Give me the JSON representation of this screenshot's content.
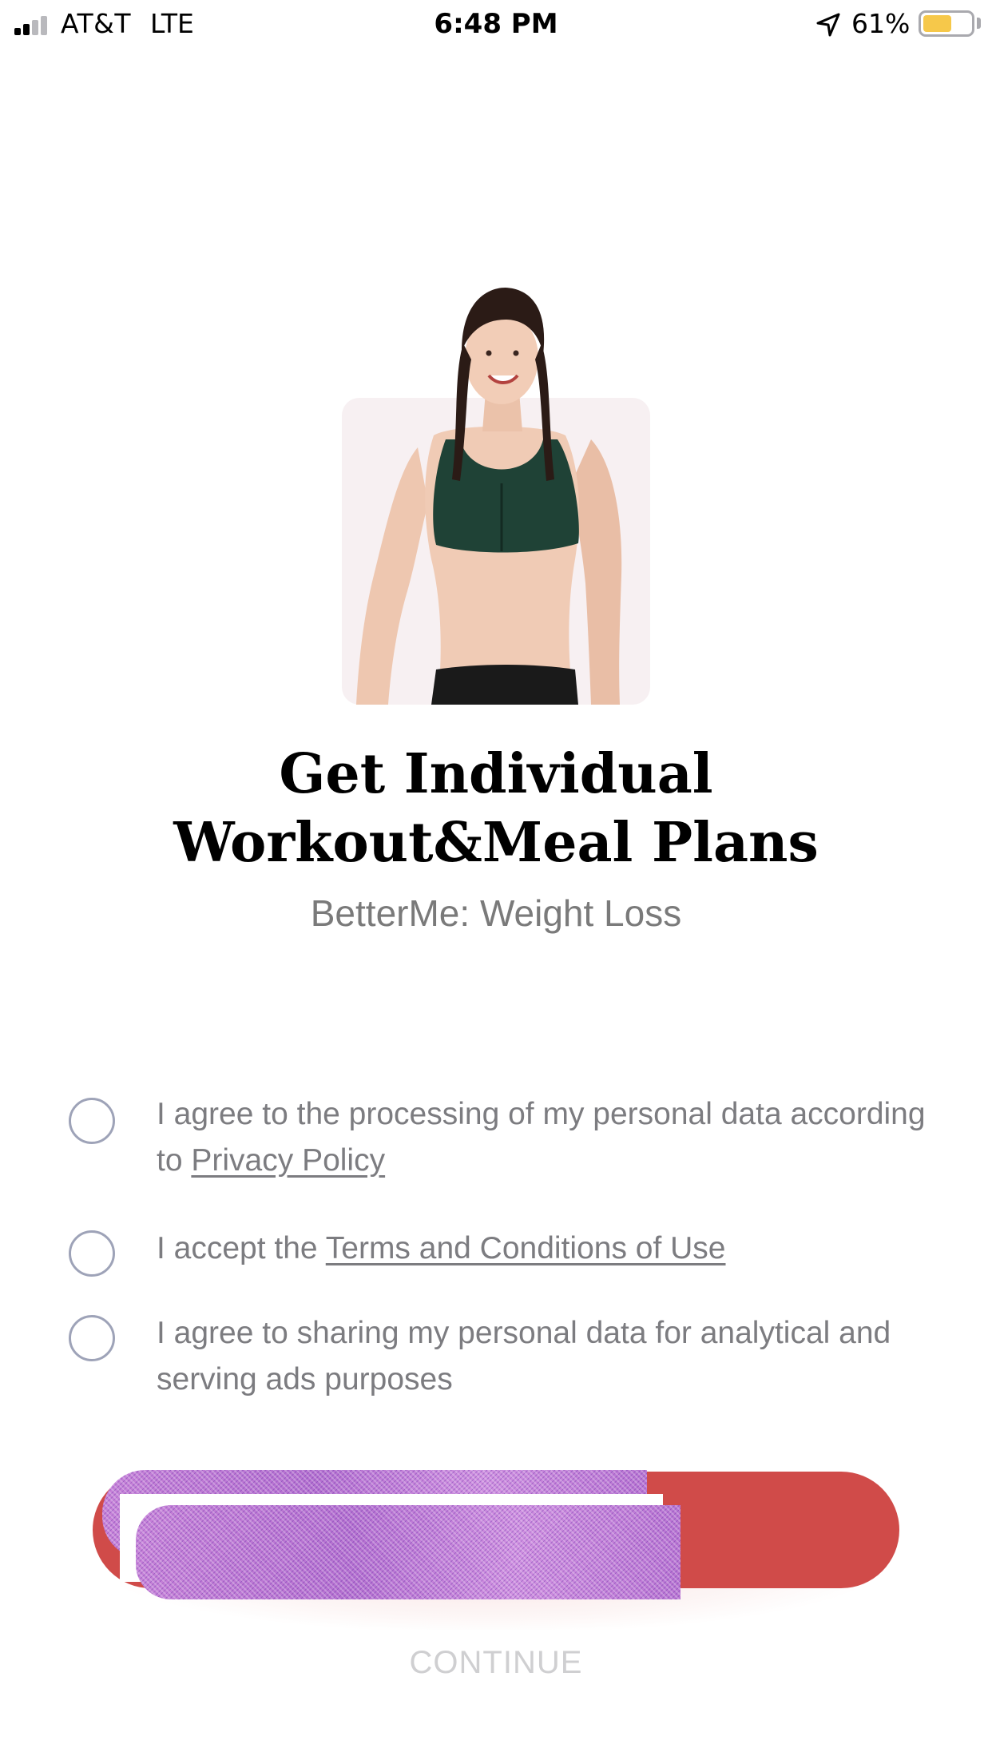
{
  "status_bar": {
    "carrier": "AT&T",
    "network": "LTE",
    "time": "6:48 PM",
    "battery_percent": "61%",
    "battery_level": 0.61,
    "icons": [
      "signal-icon",
      "location-arrow-icon",
      "battery-icon"
    ]
  },
  "hero": {
    "image_description_icon": "woman-fitness-photo"
  },
  "heading": {
    "title_line1": "Get Individual",
    "title_line2": "Workout&Meal Plans",
    "subtitle": "BetterMe: Weight Loss"
  },
  "consents": [
    {
      "text_before": "I agree to the processing of my personal data according to ",
      "link": "Privacy Policy",
      "text_after": "",
      "checked": false
    },
    {
      "text_before": "I accept the ",
      "link": "Terms and Conditions of Use",
      "text_after": "",
      "checked": false
    },
    {
      "text_before": "I agree to sharing my personal data for analytical and serving ads purposes",
      "link": "",
      "text_after": "",
      "checked": false
    }
  ],
  "buttons": {
    "continue_label": "CONTINUE"
  },
  "colors": {
    "accent": "#d04b49",
    "radio_border": "#9ea3b8",
    "body_text": "#7c7c80",
    "disabled_text": "#cfcfd1"
  }
}
